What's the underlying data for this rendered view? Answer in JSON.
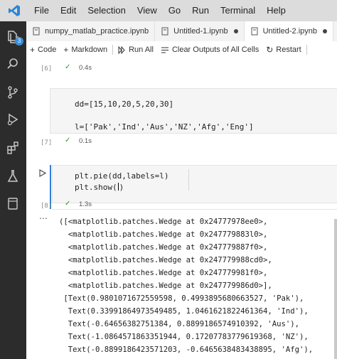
{
  "menubar": {
    "items": [
      "File",
      "Edit",
      "Selection",
      "View",
      "Go",
      "Run",
      "Terminal",
      "Help"
    ]
  },
  "activity": {
    "badge": "3"
  },
  "tabs": [
    {
      "label": "numpy_matlab_practice.ipynb"
    },
    {
      "label": "Untitled-1.ipynb"
    },
    {
      "label": "Untitled-2.ipynb"
    }
  ],
  "toolbar": {
    "code": "Code",
    "markdown": "Markdown",
    "run_all": "Run All",
    "clear_outputs": "Clear Outputs of All Cells",
    "restart": "Restart"
  },
  "cells": [
    {
      "num": "[6]",
      "time": "0.4s"
    },
    {
      "num": "[7]",
      "time": "0.1s",
      "lines": [
        "dd=[15,10,20,5,20,30]",
        "",
        "l=['Pak','Ind','Aus','NZ','Afg','Eng']"
      ]
    },
    {
      "num": "[8]",
      "time": "1.3s",
      "lines": [
        "plt.pie(dd,labels=l)",
        "plt.show("
      ]
    }
  ],
  "output": {
    "lines": [
      "([<matplotlib.patches.Wedge at 0x24777978ee0>,",
      "  <matplotlib.patches.Wedge at 0x247779883l0>,",
      "  <matplotlib.patches.Wedge at 0x247779887f0>,",
      "  <matplotlib.patches.Wedge at 0x247779988cd0>,",
      "  <matplotlib.patches.Wedge at 0x247779981f0>,",
      "  <matplotlib.patches.Wedge at 0x247779986d0>],",
      " [Text(0.9801071672559598, 0.4993895680663527, 'Pak'),",
      "  Text(0.33991864973549485, 1.0461621822461364, 'Ind'),",
      "  Text(-0.64656382751384, 0.8899186574910392, 'Aus'),",
      "  Text(-1.0864571863351944, 0.17207783779619368, 'NZ'),",
      "  Text(-0.8899186423571203, -0.6465638483438895, 'Afg'),"
    ]
  }
}
